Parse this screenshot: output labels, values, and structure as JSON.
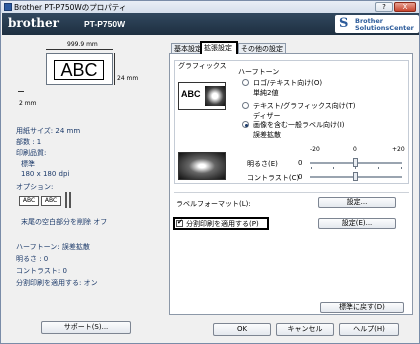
{
  "window": {
    "title": "Brother PT-P750Wのプロパティ",
    "help_btn": "?",
    "close_btn": "X"
  },
  "banner": {
    "brand": "brother",
    "model": "PT-P750W",
    "sc_line1": "Brother",
    "sc_line2": "SolutionsCenter"
  },
  "left": {
    "width_dim": "999.9 mm",
    "preview_text": "ABC",
    "height_dim": "24 mm",
    "margin_dim": "2 mm",
    "info": [
      "用紙サイズ: 24 mm",
      "部数 : 1",
      "印刷品質:",
      "標準",
      "180 x 180 dpi",
      "オプション:"
    ],
    "mini_label_1": "ABC",
    "mini_label_2": "ABC",
    "tail_note": "末尾の空白部分を削除 オフ",
    "bottom_info": [
      "ハーフトーン: 誤差拡散",
      "明るさ : 0",
      "コントラスト: 0",
      "分割印刷を適用する: オン"
    ],
    "support_button": "サポート(S)..."
  },
  "tabs": [
    {
      "label": "基本設定"
    },
    {
      "label": "拡張設定"
    },
    {
      "label": "その他の設定"
    }
  ],
  "graphics": {
    "section_title": "グラフィックス",
    "halftone_title": "ハーフトーン",
    "sample_text": "ABC",
    "options": [
      {
        "label": "ロゴ/テキスト向け(O)",
        "sub": "単純2値",
        "selected": false
      },
      {
        "label": "テキスト/グラフィックス向け(T)",
        "sub": "ディザー",
        "selected": false
      },
      {
        "label": "画像を含む一般ラベル向け(I)",
        "sub": "誤差拡散",
        "selected": true
      }
    ],
    "scale_min": "-20",
    "scale_mid": "0",
    "scale_max": "+20",
    "brightness_label": "明るさ(E)",
    "brightness_value": "0",
    "contrast_label": "コントラスト(C)",
    "contrast_value": "0"
  },
  "label_format": {
    "label": "ラベルフォーマット(L):",
    "button": "設定..."
  },
  "split_print": {
    "label": "分割印刷を適用する(P)",
    "checked": true,
    "button": "設定(E)..."
  },
  "footer": {
    "restore_button": "標準に戻す(D)",
    "ok": "OK",
    "cancel": "キャンセル",
    "help": "ヘルプ(H)"
  }
}
